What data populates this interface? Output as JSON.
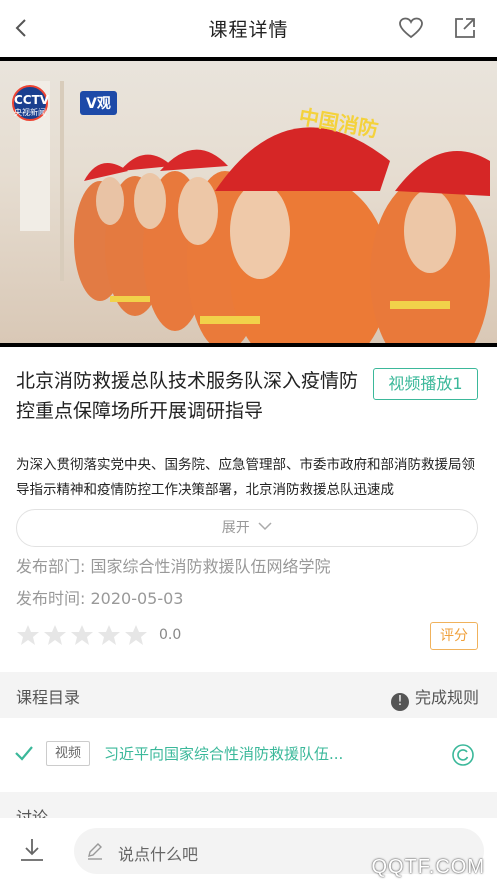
{
  "header": {
    "title": "课程详情",
    "back_icon": "chevron-left-icon",
    "favorite_icon": "heart-icon",
    "share_icon": "share-icon"
  },
  "video": {
    "channel_logo": "CCTV",
    "channel_sub": "央视新闻",
    "channel_badge": "V观",
    "helmet_text": "中国消防"
  },
  "course": {
    "title": "北京消防救援总队技术服务队深入疫情防控重点保障场所开展调研指导",
    "badge": "视频播放1",
    "description": "为深入贯彻落实党中央、国务院、应急管理部、市委市政府和部消防救援局领导指示精神和疫情防控工作决策部署，北京消防救援总队迅速成",
    "expand_label": "展开",
    "department": "发布部门: 国家综合性消防救援队伍网络学院",
    "publish_time": "发布时间: 2020-05-03",
    "score": "0.0",
    "rating_max": 5,
    "rate_button": "评分"
  },
  "catalog": {
    "label": "课程目录",
    "rule_label": "完成规则",
    "items": [
      {
        "tag": "视频",
        "title": "习近平向国家综合性消防救援队伍..."
      }
    ]
  },
  "discussion": {
    "label": "讨论"
  },
  "bottom": {
    "comment_placeholder": "说点什么吧",
    "watermark": "QQTF.COM"
  },
  "colors": {
    "accent": "#3bb89a",
    "rate": "#f0a13c"
  }
}
